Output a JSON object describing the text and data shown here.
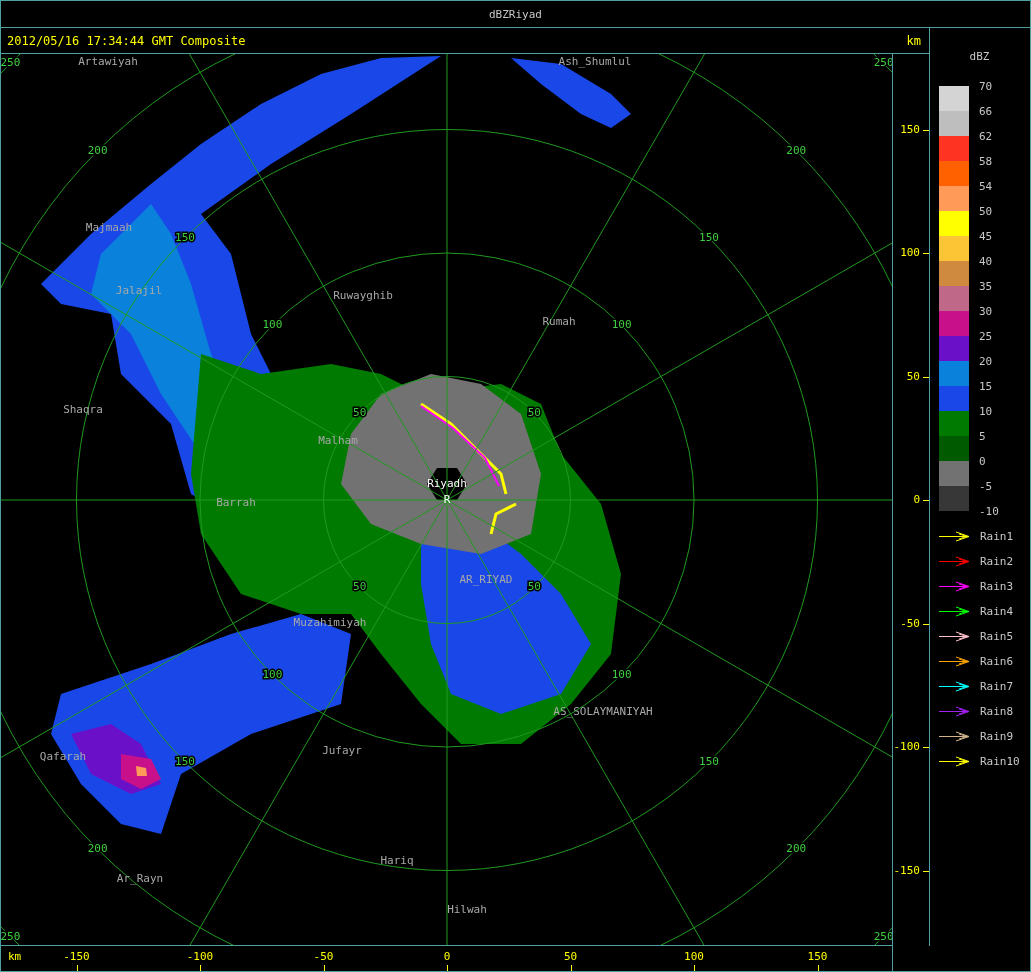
{
  "window": {
    "title": "dBZRiyad"
  },
  "header": {
    "timestamp": "2012/05/16 17:34:44 GMT Composite",
    "unit": "km"
  },
  "map": {
    "range_ring_labels": [
      "50",
      "50",
      "50",
      "50",
      "100",
      "100",
      "100",
      "100",
      "150",
      "150",
      "150",
      "150",
      "200",
      "200",
      "200",
      "200",
      "250",
      "250",
      "250",
      "250"
    ],
    "places": [
      {
        "name": "Artawiyah",
        "kind": "town"
      },
      {
        "name": "Ash_Shumlul",
        "kind": "town"
      },
      {
        "name": "Majmaah",
        "kind": "town"
      },
      {
        "name": "Jalajil",
        "kind": "town"
      },
      {
        "name": "Ruwayghib",
        "kind": "town"
      },
      {
        "name": "Rumah",
        "kind": "town"
      },
      {
        "name": "Shaqra",
        "kind": "town"
      },
      {
        "name": "Malham",
        "kind": "town"
      },
      {
        "name": "Riyadh",
        "kind": "radar"
      },
      {
        "name": "R",
        "kind": "radar"
      },
      {
        "name": "Barrah",
        "kind": "town"
      },
      {
        "name": "AR_RIYAD",
        "kind": "town"
      },
      {
        "name": "Muzahimiyah",
        "kind": "town"
      },
      {
        "name": "AS_SOLAYMANIYAH",
        "kind": "town"
      },
      {
        "name": "Jufayr",
        "kind": "town"
      },
      {
        "name": "Qafarah",
        "kind": "town"
      },
      {
        "name": "Hariq",
        "kind": "town"
      },
      {
        "name": "Ar_Rayn",
        "kind": "town"
      },
      {
        "name": "Hilwah",
        "kind": "town"
      }
    ]
  },
  "right_axis": {
    "ticks": [
      "150",
      "100",
      "50",
      "0",
      "-50",
      "-100",
      "-150"
    ]
  },
  "bottom_axis": {
    "unit": "km",
    "ticks": [
      "-150",
      "-100",
      "-50",
      "0",
      "50",
      "100",
      "150"
    ]
  },
  "legend": {
    "title": "dBZ",
    "bins": [
      {
        "color": "#d4d4d4"
      },
      {
        "color": "#bebebe"
      },
      {
        "color": "#ff3322"
      },
      {
        "color": "#ff6000"
      },
      {
        "color": "#ff9a58"
      },
      {
        "color": "#ffff00"
      },
      {
        "color": "#fbc536"
      },
      {
        "color": "#d08a40"
      },
      {
        "color": "#bf6888"
      },
      {
        "color": "#c8108a"
      },
      {
        "color": "#6a10c8"
      },
      {
        "color": "#0a82dc"
      },
      {
        "color": "#1a48e8"
      },
      {
        "color": "#007a00"
      },
      {
        "color": "#005a00"
      },
      {
        "color": "#727272"
      },
      {
        "color": "#373737"
      }
    ],
    "labels": [
      "70",
      "66",
      "62",
      "58",
      "54",
      "50",
      "45",
      "40",
      "35",
      "30",
      "25",
      "20",
      "15",
      "10",
      "5",
      "0",
      "-5",
      "-10"
    ],
    "tracks": [
      {
        "name": "Rain1",
        "color": "#ffff00"
      },
      {
        "name": "Rain2",
        "color": "#ff0000"
      },
      {
        "name": "Rain3",
        "color": "#ff00ff"
      },
      {
        "name": "Rain4",
        "color": "#00ff00"
      },
      {
        "name": "Rain5",
        "color": "#ffc0cb"
      },
      {
        "name": "Rain6",
        "color": "#ffa500"
      },
      {
        "name": "Rain7",
        "color": "#00ffff"
      },
      {
        "name": "Rain8",
        "color": "#a020f0"
      },
      {
        "name": "Rain9",
        "color": "#d2b48c"
      },
      {
        "name": "Rain10",
        "color": "#ffff00"
      }
    ]
  }
}
